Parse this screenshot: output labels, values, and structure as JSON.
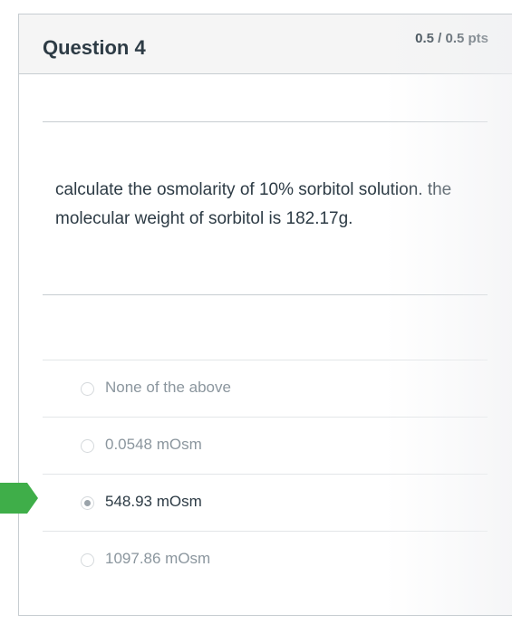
{
  "question": {
    "title": "Question 4",
    "points": "0.5 / 0.5 pts",
    "text_line1": "calculate the osmolarity of 10% sorbitol solution. the",
    "text_line2": "molecular weight of sorbitol is 182.17g."
  },
  "answers": [
    {
      "label": "None of the above",
      "selected": false
    },
    {
      "label": "0.0548 mOsm",
      "selected": false
    },
    {
      "label": "548.93 mOsm",
      "selected": true
    },
    {
      "label": "1097.86 mOsm",
      "selected": false
    }
  ],
  "colors": {
    "correct_marker": "#3fae49",
    "header_bg": "#f5f5f5",
    "text": "#2d3b45",
    "muted_text": "#8b969e"
  }
}
